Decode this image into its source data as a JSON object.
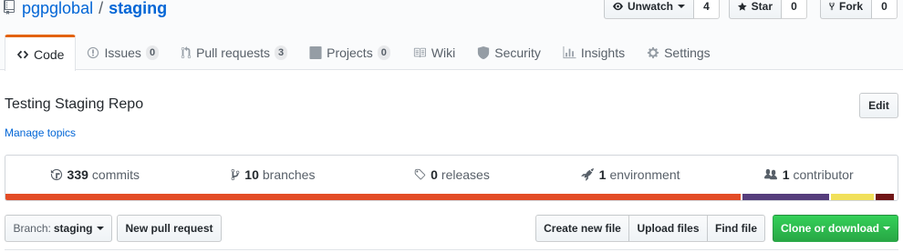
{
  "repo": {
    "owner": "pgpglobal",
    "separator": "/",
    "name": "staging"
  },
  "header_actions": {
    "watch": {
      "label": "Unwatch",
      "count": "4"
    },
    "star": {
      "label": "Star",
      "count": "0"
    },
    "fork": {
      "label": "Fork",
      "count": "0"
    }
  },
  "tabs": [
    {
      "label": "Code",
      "icon": "code-icon",
      "selected": true
    },
    {
      "label": "Issues",
      "icon": "issue-icon",
      "count": "0"
    },
    {
      "label": "Pull requests",
      "icon": "pull-request-icon",
      "count": "3"
    },
    {
      "label": "Projects",
      "icon": "project-icon",
      "count": "0"
    },
    {
      "label": "Wiki",
      "icon": "book-icon"
    },
    {
      "label": "Security",
      "icon": "shield-icon"
    },
    {
      "label": "Insights",
      "icon": "graph-icon"
    },
    {
      "label": "Settings",
      "icon": "gear-icon"
    }
  ],
  "description": "Testing Staging Repo",
  "manage_topics": "Manage topics",
  "edit_label": "Edit",
  "stats": {
    "commits": {
      "num": "339",
      "label": "commits"
    },
    "branches": {
      "num": "10",
      "label": "branches"
    },
    "releases": {
      "num": "0",
      "label": "releases"
    },
    "environments": {
      "num": "1",
      "label": "environment"
    },
    "contributors": {
      "num": "1",
      "label": "contributor"
    }
  },
  "language_bar": [
    {
      "color": "#e34c26",
      "percent": 82.6
    },
    {
      "color": "#563d7c",
      "percent": 9.9
    },
    {
      "color": "#f1e05a",
      "percent": 5.0
    },
    {
      "color": "#701516",
      "percent": 2.1
    }
  ],
  "file_nav": {
    "branch_prefix": "Branch:",
    "branch": "staging",
    "new_pull_request": "New pull request",
    "create_new_file": "Create new file",
    "upload_files": "Upload files",
    "find_file": "Find file",
    "clone_or_download": "Clone or download"
  },
  "colors": {
    "link": "#0366d6",
    "tab_selected_border": "#e36209",
    "clone_button": "#28a745"
  }
}
